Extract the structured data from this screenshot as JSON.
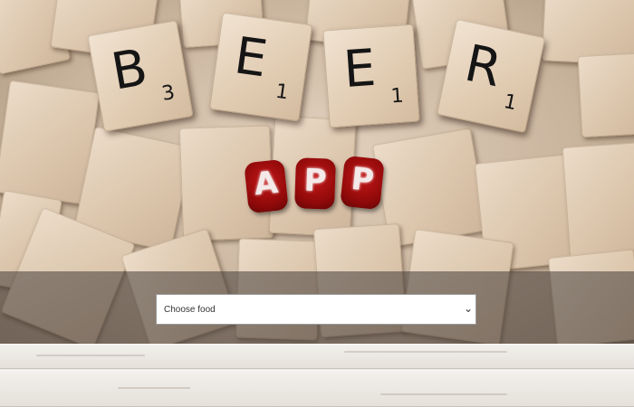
{
  "hero": {
    "tiles": [
      {
        "letter": "B",
        "score": "3"
      },
      {
        "letter": "E",
        "score": "1"
      },
      {
        "letter": "E",
        "score": "1"
      },
      {
        "letter": "R",
        "score": "1"
      }
    ],
    "app_letters": [
      "A",
      "P",
      "P"
    ]
  },
  "food_select": {
    "selected": "Choose food",
    "chevron_glyph": "⌄"
  }
}
